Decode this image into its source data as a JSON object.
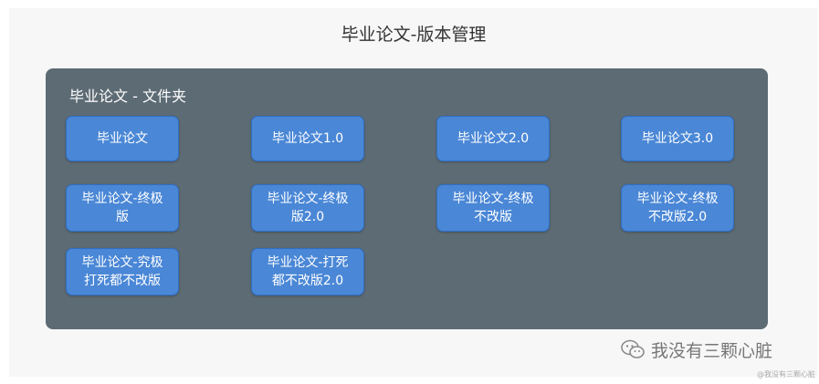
{
  "title": "毕业论文-版本管理",
  "folder": {
    "label": "毕业论文 - 文件夹",
    "files": [
      {
        "name": "毕业论文"
      },
      {
        "name": "毕业论文1.0"
      },
      {
        "name": "毕业论文2.0"
      },
      {
        "name": "毕业论文3.0"
      },
      {
        "name": "毕业论文-终极\n版"
      },
      {
        "name": "毕业论文-终极\n版2.0"
      },
      {
        "name": "毕业论文-终极\n不改版"
      },
      {
        "name": "毕业论文-终极\n不改版2.0"
      },
      {
        "name": "毕业论文-究极\n打死都不改版"
      },
      {
        "name": "毕业论文-打死\n都不改版2.0"
      }
    ]
  },
  "watermark": {
    "icon": "wechat-icon",
    "text": "我没有三颗心脏",
    "small_text": "@我没有三颗心脏"
  },
  "colors": {
    "background": "#f7f7f8",
    "folder": "#5d6b74",
    "file": "#4a87d6"
  }
}
